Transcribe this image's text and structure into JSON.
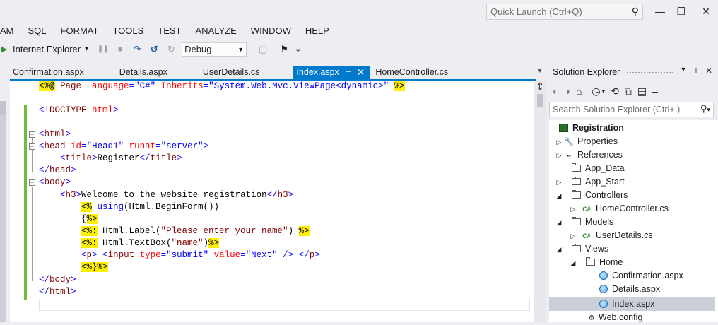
{
  "titlebar": {
    "quick_launch_placeholder": "Quick Launch (Ctrl+Q)",
    "search_icon": "⚲",
    "minimize": "—",
    "restore": "❐",
    "close": "✕"
  },
  "menu": [
    "AM",
    "SQL",
    "FORMAT",
    "TOOLS",
    "TEST",
    "ANALYZE",
    "WINDOW",
    "HELP"
  ],
  "toolbar": {
    "run_icon": "▶",
    "run_target": "Internet Explorer",
    "run_dropdown": "▾",
    "pause_icon": "❚❚",
    "stop_icon": "■",
    "restart_icon": "↻",
    "step_icon": "↷",
    "step_back_icon": "↺",
    "configuration": "Debug",
    "config_arrow": "▼",
    "deploy_icon": "▢",
    "find_icon": "⚑",
    "overflow_icon": "⌄"
  },
  "tabs": [
    {
      "label": "Confirmation.aspx",
      "active": false
    },
    {
      "label": "Details.aspx",
      "active": false
    },
    {
      "label": "UserDetails.cs",
      "active": false
    },
    {
      "label": "Index.aspx",
      "active": true,
      "pin": "⊣",
      "close": "✕"
    },
    {
      "label": "HomeController.cs",
      "active": false
    }
  ],
  "tab_dropdown": "▼",
  "editor": {
    "split_icon": "⇕",
    "fold_collapse": "−",
    "lines": {
      "l1a": "<%@",
      "l1b": " Page ",
      "l1c": "Language",
      "l1d": "=",
      "l1e": "\"C#\"",
      "l1f": " Inherits",
      "l1g": "=",
      "l1h": "\"System.Web.Mvc.ViewPage<dynamic>\"",
      "l1i": " ",
      "l1j": "%>",
      "l2a": "<!",
      "l2b": "DOCTYPE",
      "l2c": " html",
      "l2d": ">",
      "l3a": "<",
      "l3b": "html",
      "l3c": ">",
      "l4a": "<",
      "l4b": "head",
      "l4c": " id",
      "l4d": "=",
      "l4e": "\"Head1\"",
      "l4f": " runat",
      "l4g": "=",
      "l4h": "\"server\"",
      "l4i": ">",
      "l5a": "<",
      "l5b": "title",
      "l5c": ">",
      "l5d": "Register",
      "l5e": "</",
      "l5f": "title",
      "l5g": ">",
      "l6a": "</",
      "l6b": "head",
      "l6c": ">",
      "l7a": "<",
      "l7b": "body",
      "l7c": ">",
      "l8a": "<",
      "l8b": "h3",
      "l8c": ">",
      "l8d": "Welcome to the website registration",
      "l8e": "</",
      "l8f": "h3",
      "l8g": ">",
      "l9a": "<%",
      "l9b": " using",
      "l9c": "(Html.BeginForm())",
      "l10a": "{",
      "l10b": "%>",
      "l11a": "<%:",
      "l11b": " Html.Label(",
      "l11c": "\"Please enter your name\"",
      "l11d": ") ",
      "l11e": "%>",
      "l12a": "<%:",
      "l12b": " Html.TextBox(",
      "l12c": "\"name\"",
      "l12d": ")",
      "l12e": "%>",
      "l13a": "<",
      "l13b": "p",
      "l13c": ">",
      "l13d": " <",
      "l13e": "input",
      "l13f": " type",
      "l13g": "=",
      "l13h": "\"submit\"",
      "l13i": " value",
      "l13j": "=",
      "l13k": "\"Next\"",
      "l13l": " />",
      "l13m": " </",
      "l13n": "p",
      "l13o": ">",
      "l14a": "<%",
      "l14b": "}",
      "l14c": "%>",
      "l15a": "</",
      "l15b": "body",
      "l15c": ">",
      "l16a": "</",
      "l16b": "html",
      "l16c": ">"
    }
  },
  "solution_explorer": {
    "title": "Solution Explorer",
    "ctrl_dropdown": "▼",
    "ctrl_pin": "⊥",
    "ctrl_close": "✕",
    "toolbar": {
      "back": "◐",
      "forward": "◑",
      "home": "⌂",
      "history": "◷",
      "history_dd": "▾",
      "sync": "⟲",
      "collapse": "⧉",
      "show_all": "▤",
      "properties": "‒"
    },
    "search_placeholder": "Search Solution Explorer (Ctrl+;)",
    "search_icon": "⚲",
    "search_dd": "▾",
    "expand_closed": "▷",
    "expand_open": "◢",
    "cs_badge": "C#",
    "items": {
      "registration": "Registration",
      "properties": "Properties",
      "references": "References",
      "app_data": "App_Data",
      "app_start": "App_Start",
      "controllers": "Controllers",
      "homecontroller": "HomeController.cs",
      "models": "Models",
      "userdetails": "UserDetails.cs",
      "views": "Views",
      "home": "Home",
      "confirmation": "Confirmation.aspx",
      "details": "Details.aspx",
      "index": "Index.aspx",
      "webconfig": "Web.config"
    },
    "properties_icon": "🔧",
    "references_icon": "▪▪"
  }
}
